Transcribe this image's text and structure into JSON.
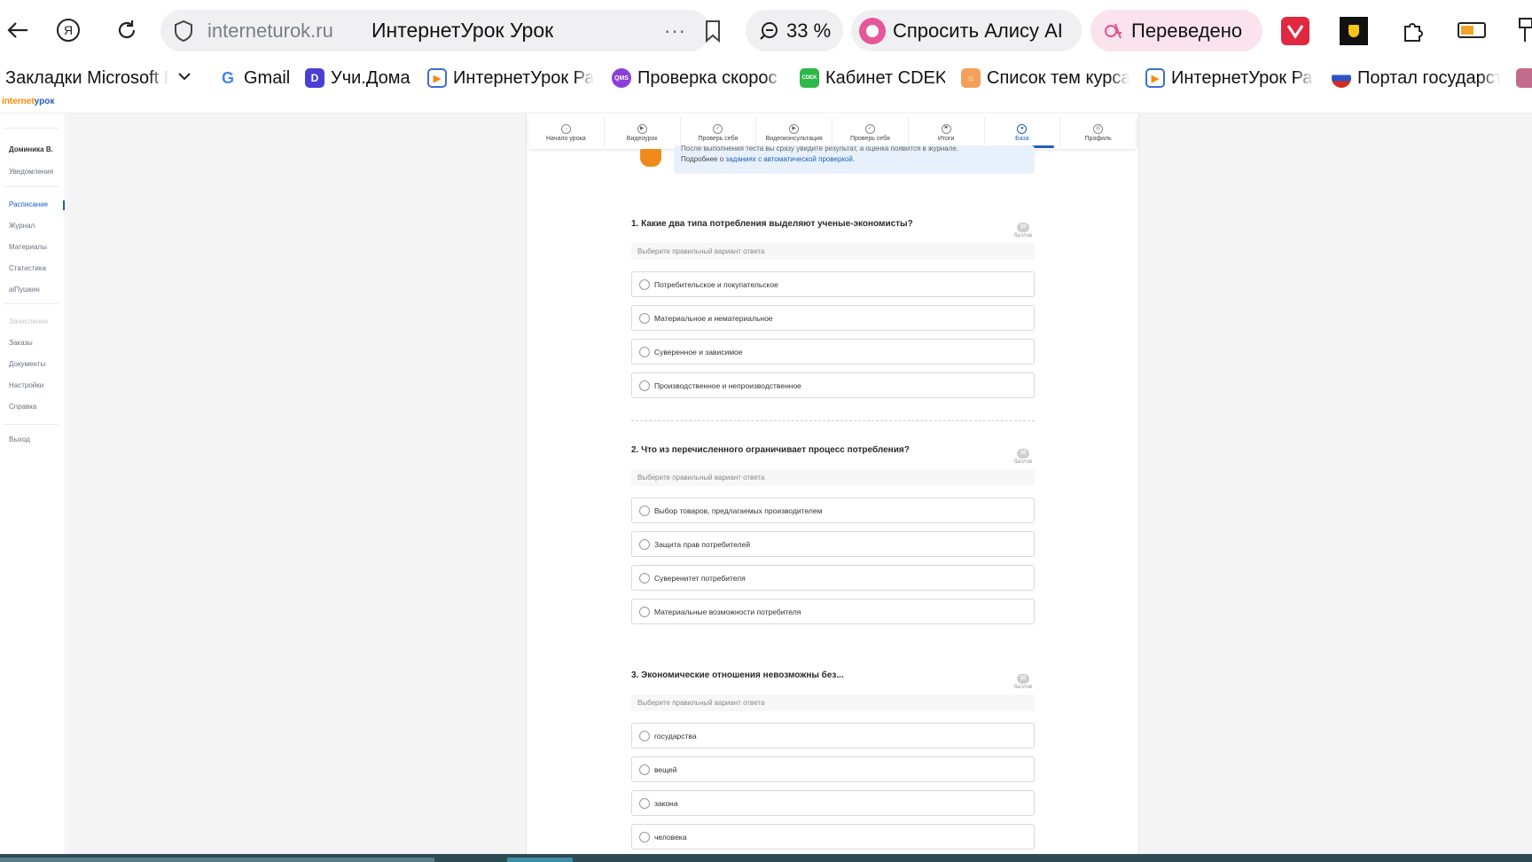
{
  "browser": {
    "url_domain": "interneturok.ru",
    "page_title": "ИнтернетУрок Урок",
    "more": "···",
    "zoom": "33 %",
    "alice_label": "Спросить Алису AI",
    "translate_label": "Переведено"
  },
  "bookmarks": [
    {
      "label": "Закладки Microsoft E"
    },
    {
      "label": "Gmail"
    },
    {
      "label": "Учи.Дома"
    },
    {
      "label": "ИнтернетУрок Ра"
    },
    {
      "label": "Проверка скорос"
    },
    {
      "label": "Кабинет CDEK"
    },
    {
      "label": "Список тем курса"
    },
    {
      "label": "ИнтернетУрок Ра"
    },
    {
      "label": "Портал государст"
    }
  ],
  "site": {
    "logo_a": "internet",
    "logo_b": "урок"
  },
  "sidebar": {
    "user": "Доминика В.",
    "notifications": "Уведомления",
    "schedule": "Расписание",
    "journal": "Журнал",
    "materials": "Материалы",
    "statistics": "Статистика",
    "aipushkin": "aiПушкин",
    "enrollment": "Зачисление",
    "orders": "Заказы",
    "documents": "Документы",
    "settings": "Настройки",
    "help": "Справка",
    "logout": "Выход"
  },
  "steps": [
    {
      "label": "Начало урока"
    },
    {
      "label": "Видеоурок"
    },
    {
      "label": "Проверь себя"
    },
    {
      "label": "Видеоконсультация"
    },
    {
      "label": "Проверь себя"
    },
    {
      "label": "Итоги"
    },
    {
      "label": "База"
    },
    {
      "label": "Профиль"
    }
  ],
  "info": {
    "line1": "После выполнения теста вы сразу увидите результат, а оценка появится в журнале.",
    "line2_prefix": "Подробнее о",
    "line2_link": "заданиях с автоматической проверкой"
  },
  "hint": "Выберите правильный вариант ответа",
  "points_label": "баллов",
  "questions": [
    {
      "title": "1. Какие два типа потребления выделяют ученые-экономисты?",
      "points": "10",
      "options": [
        "Потребительское и покупательское",
        "Материальное и нематериальное",
        "Суверенное и зависимое",
        "Производственное и непроизводственное"
      ]
    },
    {
      "title": "2. Что из перечисленного ограничивает процесс потребления?",
      "points": "10",
      "options": [
        "Выбор товаров, предлагаемых производителем",
        "Защита прав потребителей",
        "Суверенитет потребителя",
        "Материальные возможности потребителя"
      ]
    },
    {
      "title": "3. Экономические отношения невозможны без...",
      "points": "10",
      "options": [
        "государства",
        "вещей",
        "закона",
        "человека"
      ]
    }
  ]
}
